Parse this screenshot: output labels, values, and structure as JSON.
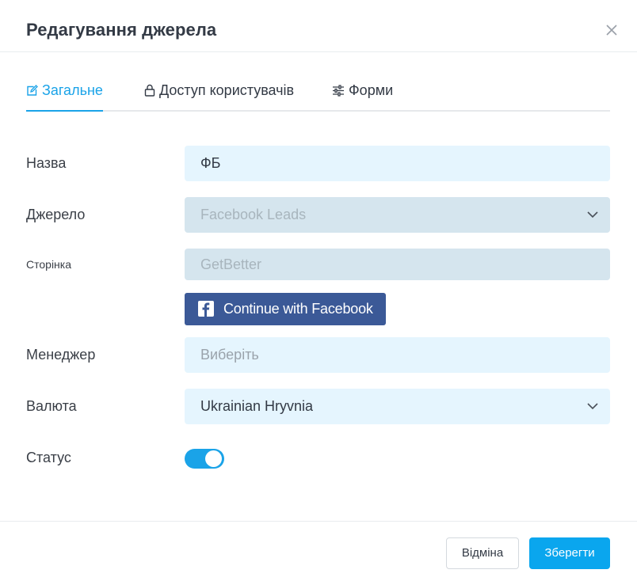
{
  "dialog": {
    "title": "Редагування джерела"
  },
  "tabs": [
    {
      "label": "Загальне",
      "icon": "edit-icon",
      "active": true
    },
    {
      "label": "Доступ користувачів",
      "icon": "lock-icon",
      "active": false
    },
    {
      "label": "Форми",
      "icon": "sliders-icon",
      "active": false
    }
  ],
  "form": {
    "name": {
      "label": "Назва",
      "value": "ФБ"
    },
    "source": {
      "label": "Джерело",
      "value": "Facebook Leads"
    },
    "page": {
      "label": "Сторінка",
      "value": "GetBetter"
    },
    "facebook_button": {
      "label": "Continue with Facebook"
    },
    "manager": {
      "label": "Менеджер",
      "placeholder": "Виберіть"
    },
    "currency": {
      "label": "Валюта",
      "value": "Ukrainian Hryvnia"
    },
    "status": {
      "label": "Статус",
      "enabled": true
    }
  },
  "footer": {
    "cancel_label": "Відміна",
    "save_label": "Зберегти"
  },
  "colors": {
    "accent": "#1aa3e8",
    "facebook": "#3b5997",
    "input_bg": "#e5f5fe",
    "disabled_bg": "#d5e5ee"
  }
}
